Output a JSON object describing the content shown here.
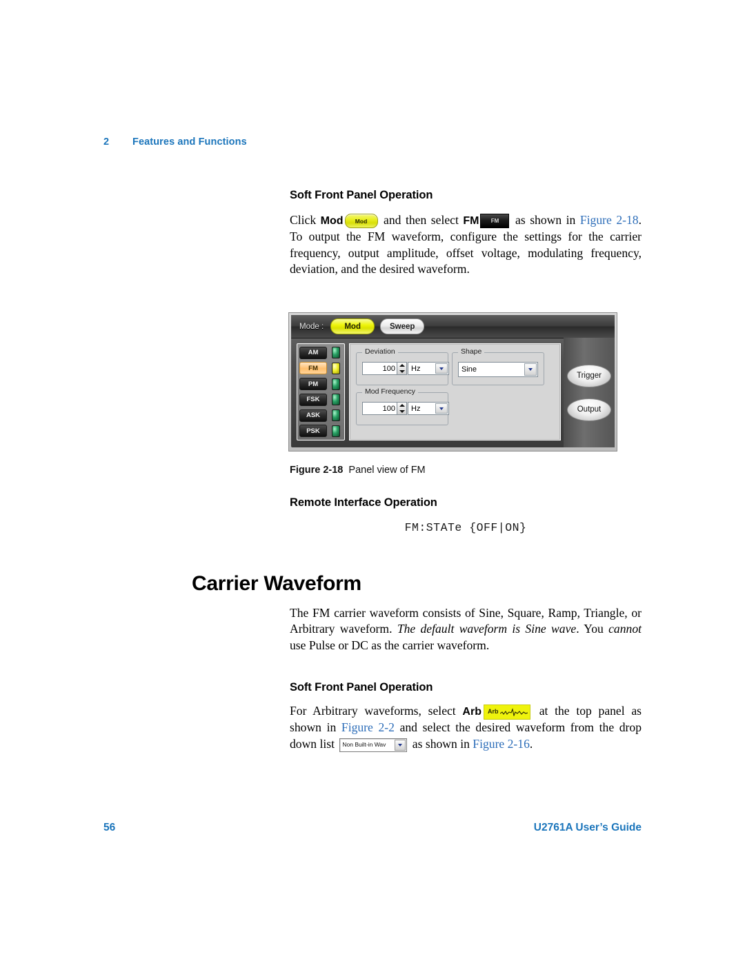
{
  "running_header": {
    "chapter_number": "2",
    "chapter_title": "Features and Functions"
  },
  "sections": {
    "soft_front_panel_1": {
      "heading": "Soft Front Panel Operation",
      "text_1": "Click ",
      "bold_mod": "Mod",
      "mod_button_label": "Mod",
      "text_2": " and then select ",
      "bold_fm": "FM",
      "fm_button_label": "FM",
      "text_3": " as shown in ",
      "link_figure": "Figure 2-18",
      "text_4": ". To output the FM waveform, configure the settings for the carrier frequency, output amplitude, offset voltage, modulating frequency, deviation, and the desired waveform."
    },
    "remote_interface": {
      "heading": "Remote Interface Operation",
      "command": "FM:STATe {OFF|ON}"
    },
    "carrier_waveform": {
      "heading": "Carrier Waveform",
      "text_1": "The FM carrier waveform consists of Sine, Square, Ramp, Triangle, or Arbitrary waveform. ",
      "italic_1": "The default waveform is Sine wave",
      "text_2": ". You ",
      "italic_2": "cannot",
      "text_3": " use Pulse or DC as the carrier waveform."
    },
    "soft_front_panel_2": {
      "heading": "Soft Front Panel Operation",
      "text_1": "For Arbitrary waveforms, select ",
      "bold_arb": "Arb",
      "arb_button_label": "Arb",
      "text_2": " at the top panel as shown in ",
      "link_figure_2_2": "Figure 2-2",
      "text_3": " and select the desired waveform from the drop down list ",
      "dropdown_value": "Non Built-in Wav",
      "text_4": " as shown in ",
      "link_figure_2_16": "Figure 2-16",
      "text_5": "."
    }
  },
  "figure": {
    "caption_label": "Figure 2-18",
    "caption_text": "Panel view of FM",
    "panel": {
      "mode_label": "Mode :",
      "mode_buttons": [
        {
          "label": "Mod",
          "state": "on"
        },
        {
          "label": "Sweep",
          "state": "off"
        }
      ],
      "modulation_list": [
        {
          "label": "AM",
          "selected": false,
          "led": "green"
        },
        {
          "label": "FM",
          "selected": true,
          "led": "yellow"
        },
        {
          "label": "PM",
          "selected": false,
          "led": "green"
        },
        {
          "label": "FSK",
          "selected": false,
          "led": "green"
        },
        {
          "label": "ASK",
          "selected": false,
          "led": "green"
        },
        {
          "label": "PSK",
          "selected": false,
          "led": "green"
        }
      ],
      "groups": {
        "deviation": {
          "legend": "Deviation",
          "value": "100",
          "unit": "Hz"
        },
        "mod_frequency": {
          "legend": "Mod Frequency",
          "value": "100",
          "unit": "Hz"
        },
        "shape": {
          "legend": "Shape",
          "value": "Sine"
        }
      },
      "action_buttons": [
        {
          "label": "Trigger"
        },
        {
          "label": "Output"
        }
      ]
    }
  },
  "footer": {
    "page_number": "56",
    "guide_title": "U2761A User’s Guide"
  },
  "colors": {
    "accent_blue": "#1b75bb",
    "link_blue": "#2b6cb8",
    "highlight_yellow": "#eff30d",
    "selected_orange": "#ffbf6e"
  }
}
